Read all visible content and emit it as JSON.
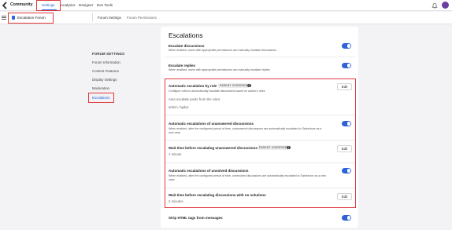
{
  "topbar": {
    "app_name": "Community",
    "nav": [
      "Settings",
      "Analytics",
      "Designer",
      "Dev Tools"
    ],
    "active_nav": "Settings"
  },
  "subbar": {
    "forum_name": "Escalation Forum",
    "tabs": [
      "Forum Settings",
      "Forum Permissions"
    ]
  },
  "leftnav": {
    "heading": "FORUM SETTINGS",
    "items": [
      "Forum Information",
      "Content Features",
      "Display Settings",
      "Moderation",
      "Escalations"
    ],
    "active_item": "Escalations"
  },
  "main": {
    "title": "Escalations",
    "edit_label": "Edit",
    "info_glyph": "i",
    "settings": [
      {
        "title": "Escalate discussions",
        "desc": "When enabled, users with appropriate permissions can manually escalate discussions",
        "control": "toggle",
        "on": true
      },
      {
        "title": "Escalate replies",
        "desc": "When enabled, users with appropriate permissions can manually escalate replies",
        "control": "toggle",
        "on": true
      },
      {
        "title": "Automatic escalation by role",
        "badge": "PARENT OVERRIDE",
        "desc": "Configure roles to automatically escalate discussions based on author's roles",
        "value_label": "Auto escalate posts from the roles:",
        "value": "admin, hgdys",
        "control": "edit"
      },
      {
        "title": "Automatic escalations of unanswered discussions",
        "desc": "When enabled, after the configured period of time, unanswered discussions are automatically escalated to Salesforce as a new case",
        "control": "toggle",
        "on": true
      },
      {
        "title": "Wait time before escalating unanswered discussions",
        "badge": "PARENT OVERRIDE",
        "value": "1 minute",
        "control": "edit"
      },
      {
        "title": "Automatic escalations of unsolved discussions",
        "desc": "When enabled, after the configured period of time, unresolved discussions are automatically escalated to Salesforce as a new case",
        "control": "toggle",
        "on": true
      },
      {
        "title": "Wait time before escalating discussions with no solutions",
        "value": "2 minutes",
        "control": "edit"
      },
      {
        "title": "Strip HTML tags from messages",
        "control": "toggle",
        "on": true
      }
    ]
  },
  "colors": {
    "accent": "#2d62d8",
    "highlight": "#e0383e",
    "avatar": "#6b3fa0"
  },
  "icons": [
    "logo-icon",
    "bell-icon",
    "avatar",
    "hamburger-icon",
    "forum-icon",
    "info-icon"
  ]
}
